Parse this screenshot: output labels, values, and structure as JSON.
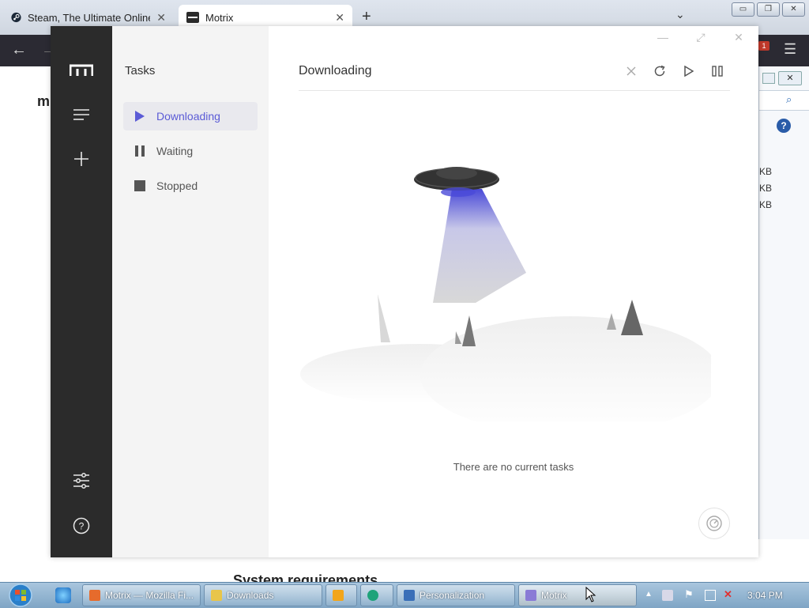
{
  "browser": {
    "tabs": [
      {
        "title": "Steam, The Ultimate Online Gam",
        "active": false
      },
      {
        "title": "Motrix",
        "active": true
      }
    ],
    "window_controls": {
      "minimize": "▭",
      "restore": "❐",
      "close": "✕"
    }
  },
  "background_page": {
    "heading": "System requirements",
    "right_window": {
      "rows": [
        "KB",
        "KB",
        "KB"
      ],
      "badge": "1"
    }
  },
  "motrix": {
    "sidebar": {
      "title": "Tasks",
      "items": [
        {
          "label": "Downloading",
          "icon": "play-icon",
          "active": true
        },
        {
          "label": "Waiting",
          "icon": "pause-icon",
          "active": false
        },
        {
          "label": "Stopped",
          "icon": "stop-icon",
          "active": false
        }
      ]
    },
    "main": {
      "title": "Downloading",
      "empty_message": "There are no current tasks",
      "actions": [
        "close-icon",
        "refresh-icon",
        "resume-all-icon",
        "pause-all-icon"
      ]
    },
    "rail": {
      "icons": [
        "motrix-logo-icon",
        "task-list-icon",
        "add-task-icon",
        "preferences-icon",
        "help-icon"
      ]
    },
    "accent": "#5b5bd6"
  },
  "taskbar": {
    "tasks": [
      {
        "label": "Motrix — Mozilla Fi...",
        "icon_color": "#e66b2c"
      },
      {
        "label": "Downloads",
        "icon_color": "#e8c54a"
      },
      {
        "label": "",
        "icon_color": "#f2a51a"
      },
      {
        "label": "",
        "icon_color": "#1fa37a"
      },
      {
        "label": "Personalization",
        "icon_color": "#3a6fb8"
      },
      {
        "label": "Motrix",
        "icon_color": "#8a7bd6"
      }
    ],
    "clock": "3:04 PM"
  }
}
